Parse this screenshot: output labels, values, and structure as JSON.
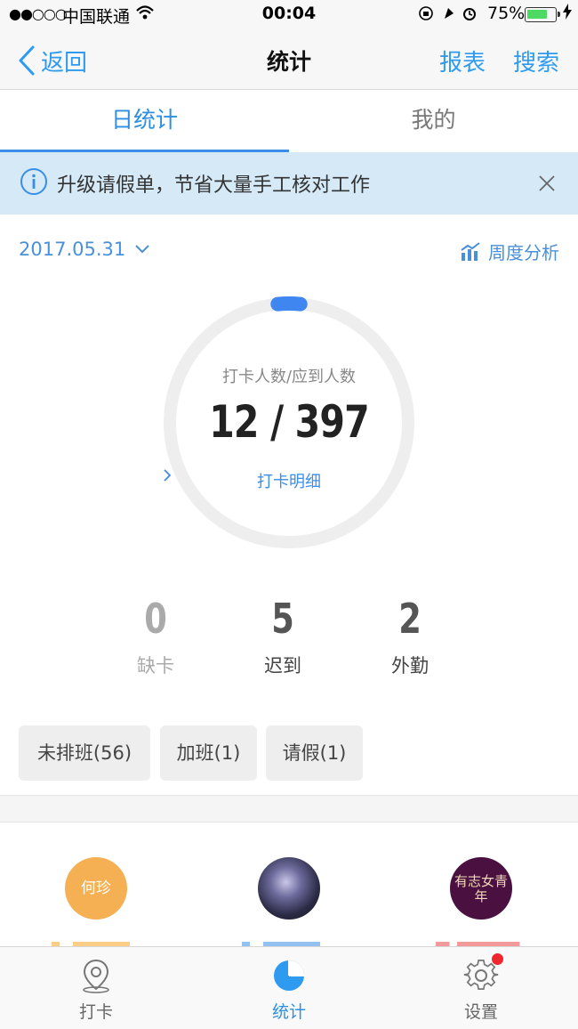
{
  "status_bar": {
    "signal": "●●○○○",
    "carrier": "中国联通",
    "time": "00:04",
    "battery_percent": "75%",
    "battery_level": 0.75
  },
  "nav": {
    "back_label": "返回",
    "title": "统计",
    "report_label": "报表",
    "search_label": "搜索"
  },
  "tabs": [
    {
      "label": "日统计",
      "active": true
    },
    {
      "label": "我的",
      "active": false
    }
  ],
  "banner": {
    "text": "升级请假单，节省大量手工核对工作"
  },
  "date": {
    "value": "2017.05.31",
    "weekly_analysis_label": "周度分析"
  },
  "ring": {
    "caption": "打卡人数/应到人数",
    "checked_in": 12,
    "expected": 397,
    "count_text": "12 / 397",
    "detail_label": "打卡明细"
  },
  "stats": [
    {
      "value": "0",
      "label": "缺卡"
    },
    {
      "value": "5",
      "label": "迟到"
    },
    {
      "value": "2",
      "label": "外勤"
    }
  ],
  "chips": [
    {
      "label": "未排班(56)"
    },
    {
      "label": "加班(1)"
    },
    {
      "label": "请假(1)"
    }
  ],
  "people": [
    {
      "avatar_text": "何珍"
    },
    {
      "avatar_text": ""
    },
    {
      "avatar_text": "有志女青年"
    }
  ],
  "tab_bar": [
    {
      "label": "打卡",
      "icon": "location-pin-icon"
    },
    {
      "label": "统计",
      "icon": "pie-chart-icon",
      "active": true
    },
    {
      "label": "设置",
      "icon": "gear-icon",
      "badge": true
    }
  ],
  "colors": {
    "accent": "#2e9af0",
    "ring_track": "#eeeeee",
    "ring_progress": "#3f86f0",
    "banner_bg": "#d5e9f7",
    "badge": "#f0262e"
  }
}
